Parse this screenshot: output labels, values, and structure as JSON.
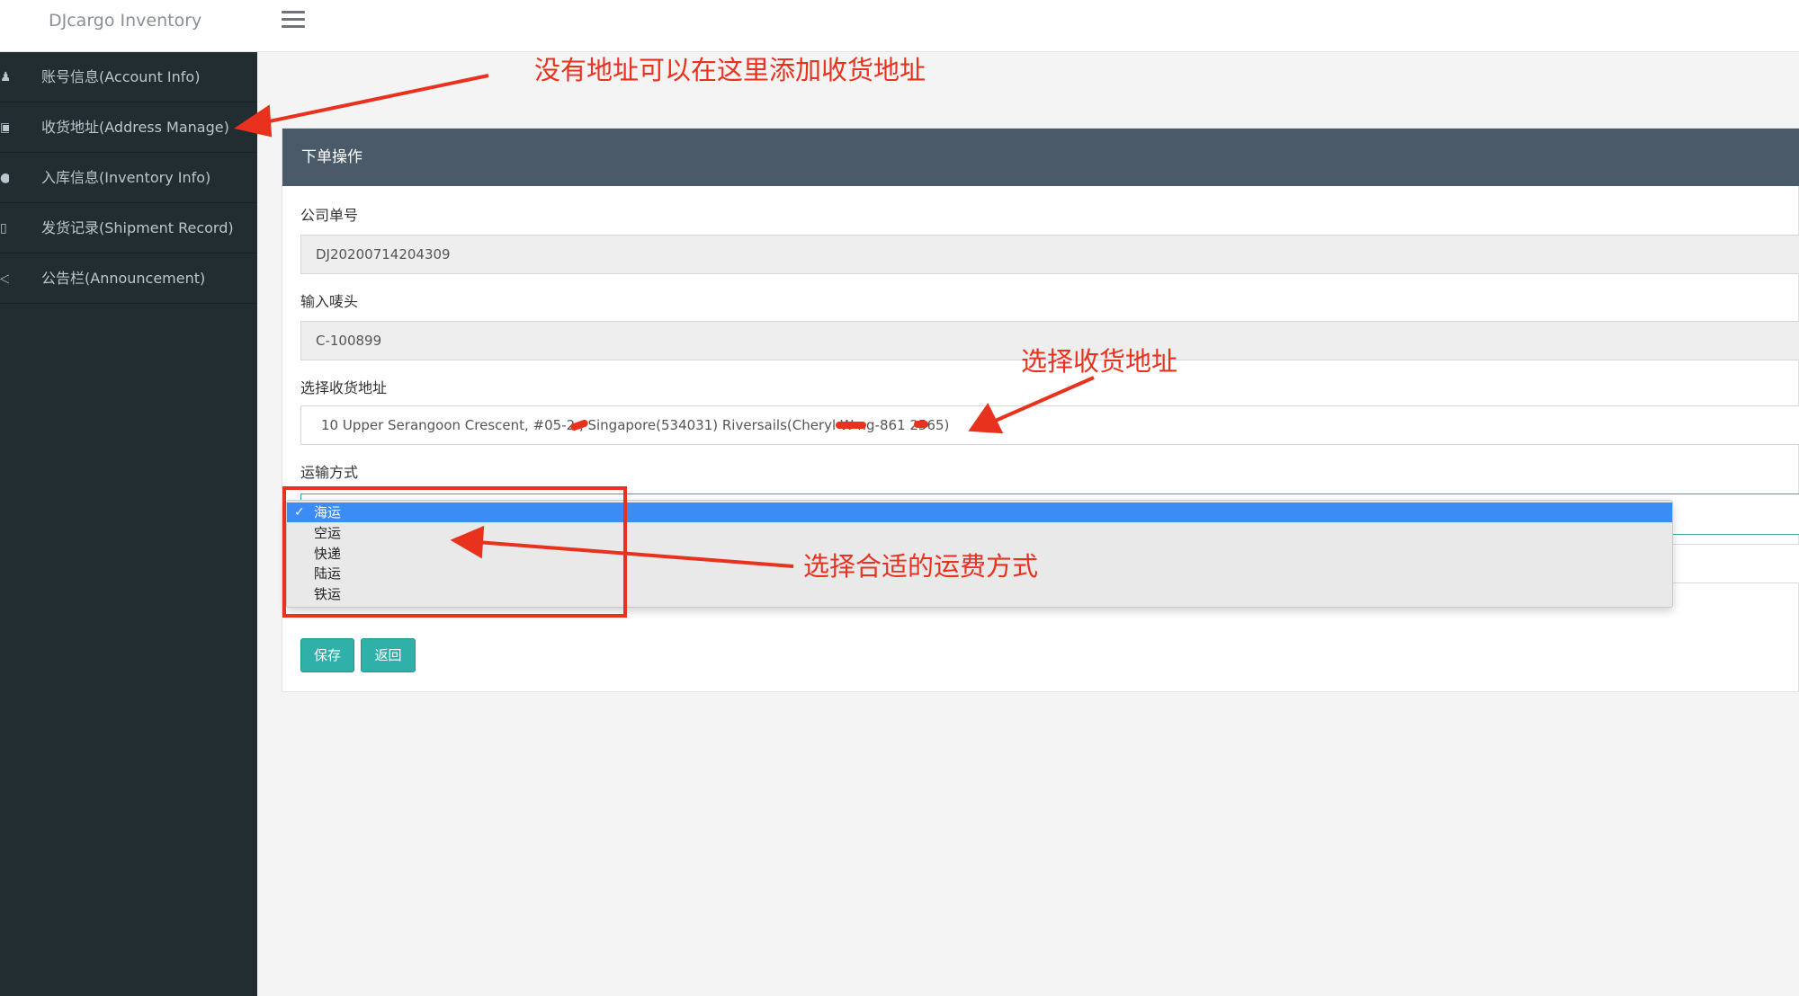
{
  "app": {
    "brand": "DJcargo Inventory"
  },
  "sidebar": {
    "items": [
      {
        "label": "账号信息(Account Info)",
        "icon": "user-icon"
      },
      {
        "label": "收货地址(Address Manage)",
        "icon": "address-icon"
      },
      {
        "label": "入库信息(Inventory Info)",
        "icon": "inventory-icon"
      },
      {
        "label": "发货记录(Shipment Record)",
        "icon": "shipment-icon"
      },
      {
        "label": "公告栏(Announcement)",
        "icon": "announcement-icon"
      }
    ]
  },
  "panel": {
    "title": "下单操作",
    "fields": {
      "company_order_label": "公司单号",
      "company_order_value": "DJ20200714204309",
      "mark_label": "输入唛头",
      "mark_value": "C-100899",
      "address_label": "选择收货地址",
      "address_value": "10 Upper Serangoon Crescent, #05-2  , Singapore(534031) Riversails(Cheryl W   ng-861   2565)",
      "shipping_label": "运输方式"
    },
    "shipping_options": [
      {
        "label": "海运",
        "selected": true
      },
      {
        "label": "空运",
        "selected": false
      },
      {
        "label": "快递",
        "selected": false
      },
      {
        "label": "陆运",
        "selected": false
      },
      {
        "label": "铁运",
        "selected": false
      }
    ],
    "buttons": {
      "save": "保存",
      "back": "返回"
    }
  },
  "annotations": {
    "add_address": "没有地址可以在这里添加收货地址",
    "select_address": "选择收货地址",
    "select_shipping": "选择合适的运费方式",
    "color": "#e8321e"
  },
  "colors": {
    "sidebar_bg": "#222d32",
    "panel_header_bg": "#4a5a68",
    "button_bg": "#2fb0a9",
    "selected_option_bg": "#3b8cf5"
  }
}
